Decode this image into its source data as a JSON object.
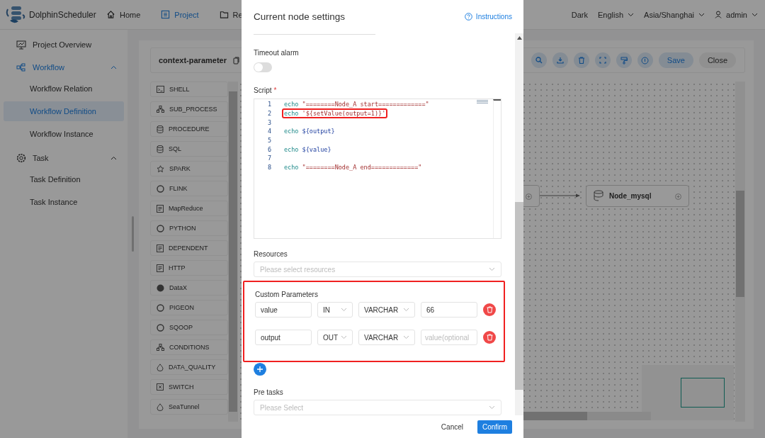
{
  "header": {
    "logo": "DolphinScheduler",
    "nav": [
      {
        "label": "Home",
        "selected": false
      },
      {
        "label": "Project",
        "selected": true
      },
      {
        "label": "Re",
        "selected": false
      }
    ],
    "theme": "Dark",
    "language": "English",
    "timezone": "Asia/Shanghai",
    "user": "admin"
  },
  "sidebar": {
    "items": [
      {
        "kind": "link",
        "label": "Project Overview",
        "selected": false
      },
      {
        "kind": "group",
        "label": "Workflow",
        "selected": true,
        "expanded": true,
        "children": [
          {
            "label": "Workflow Relation",
            "selected": false
          },
          {
            "label": "Workflow Definition",
            "selected": true
          },
          {
            "label": "Workflow Instance",
            "selected": false
          }
        ]
      },
      {
        "kind": "group",
        "label": "Task",
        "selected": false,
        "expanded": true,
        "children": [
          {
            "label": "Task Definition",
            "selected": false
          },
          {
            "label": "Task Instance",
            "selected": false
          }
        ]
      }
    ]
  },
  "workflow": {
    "title": "context-parameter",
    "save": "Save",
    "close": "Close"
  },
  "palette": [
    "SHELL",
    "SUB_PROCESS",
    "PROCEDURE",
    "SQL",
    "SPARK",
    "FLINK",
    "MapReduce",
    "PYTHON",
    "DEPENDENT",
    "HTTP",
    "DataX",
    "PIGEON",
    "SQOOP",
    "CONDITIONS",
    "DATA_QUALITY",
    "SWITCH",
    "SeaTunnel"
  ],
  "canvas": {
    "nodes": [
      {
        "kind": "task"
      },
      {
        "kind": "sql",
        "label": "Node_mysql"
      }
    ]
  },
  "dialog": {
    "title": "Current node settings",
    "help": "Instructions",
    "timeout_alarm": {
      "label": "Timeout alarm",
      "on": false
    },
    "script": {
      "label": "Script",
      "required_mark": "*",
      "lines": [
        {
          "number": "1",
          "highlighted": false,
          "tokens": [
            {
              "kind": "keyword",
              "text": "echo"
            },
            {
              "kind": "string",
              "text": "\"========Node_A start=============\""
            }
          ]
        },
        {
          "number": "2",
          "highlighted": true,
          "tokens": [
            {
              "kind": "keyword",
              "text": "echo"
            },
            {
              "kind": "string",
              "text": "'${setValue(output=1)}'"
            }
          ]
        },
        {
          "number": "3"
        },
        {
          "number": "4",
          "highlighted": false,
          "tokens": [
            {
              "kind": "keyword",
              "text": "echo"
            },
            {
              "kind": "variable",
              "text": "${output}"
            }
          ]
        },
        {
          "number": "5"
        },
        {
          "number": "6",
          "highlighted": false,
          "tokens": [
            {
              "kind": "keyword",
              "text": "echo"
            },
            {
              "kind": "variable",
              "text": "${value}"
            }
          ]
        },
        {
          "number": "7"
        },
        {
          "number": "8",
          "highlighted": false,
          "tokens": [
            {
              "kind": "keyword",
              "text": "echo"
            },
            {
              "kind": "string",
              "text": "\"========Node_A end=============\""
            }
          ]
        }
      ]
    },
    "resources": {
      "label": "Resources",
      "placeholder": "Please select resources"
    },
    "custom_parameters": {
      "label": "Custom Parameters",
      "highlighted": true,
      "rows": [
        {
          "name": "value",
          "direction": "IN",
          "type": "VARCHAR",
          "value": "66"
        },
        {
          "name": "output",
          "direction": "OUT",
          "type": "VARCHAR",
          "placeholder": "value(optional"
        }
      ]
    },
    "pre_tasks": {
      "label": "Pre tasks",
      "placeholder": "Please Select"
    },
    "cancel": "Cancel",
    "confirm": "Confirm"
  }
}
